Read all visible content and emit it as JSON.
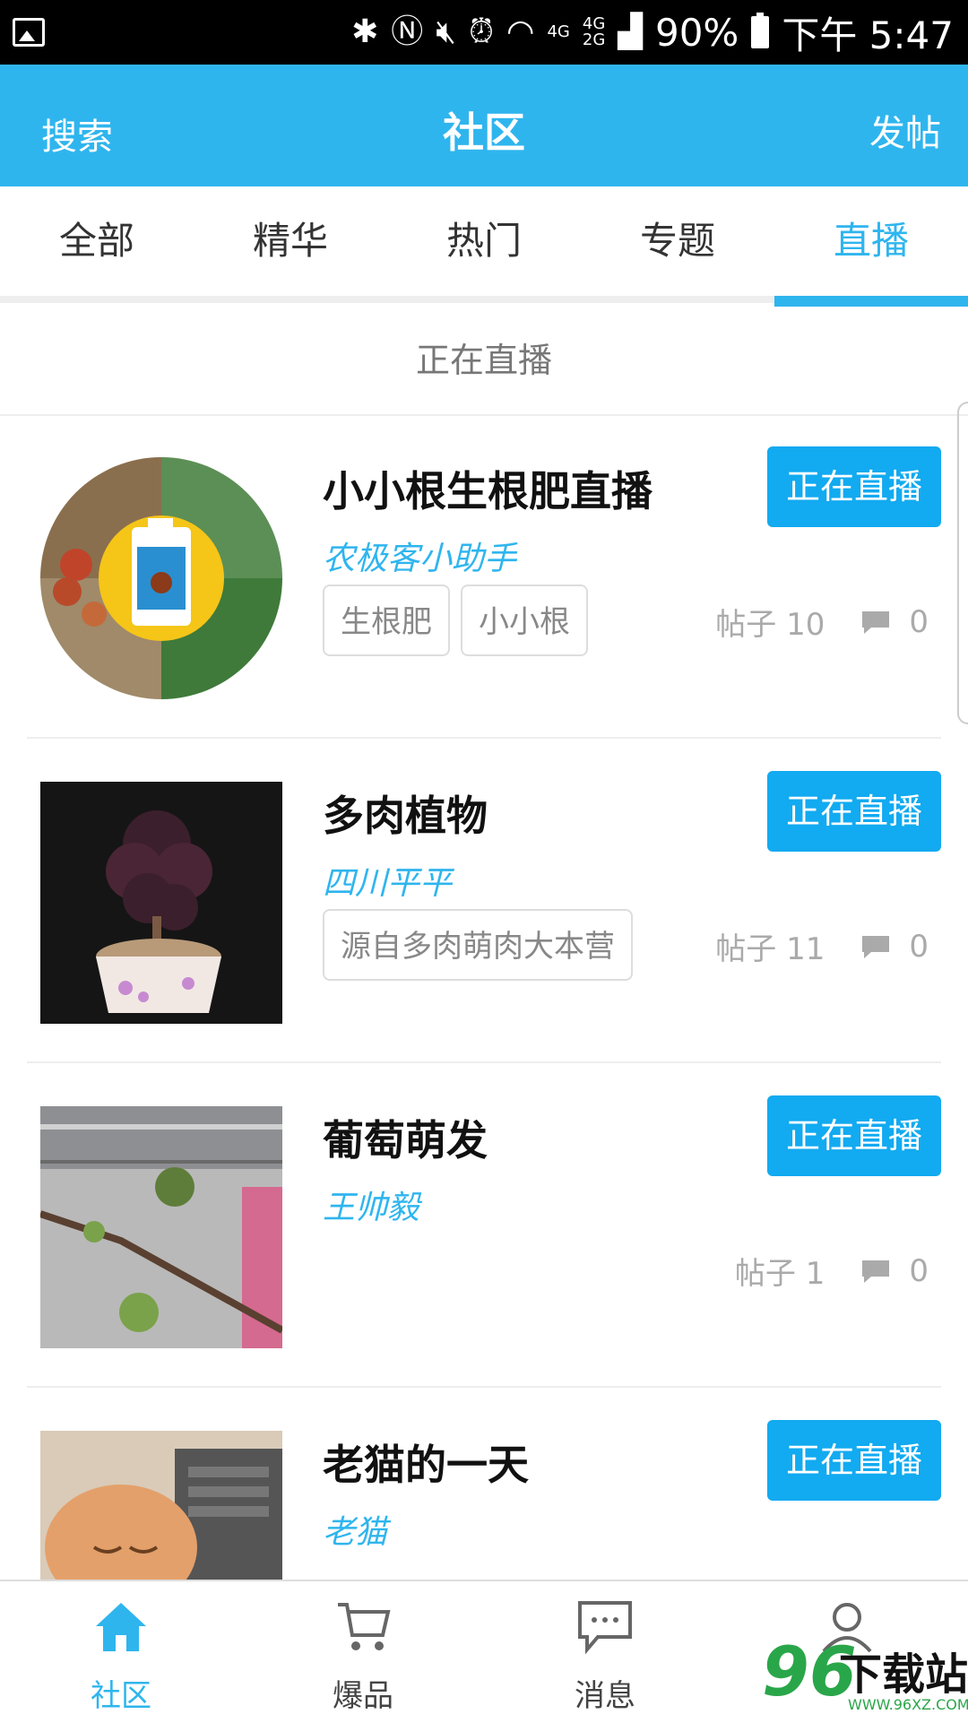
{
  "status_bar": {
    "time": "下午 5:47",
    "battery": "90%",
    "net_top": "4G",
    "net_bottom": "2G",
    "net_left": "4G"
  },
  "header": {
    "search": "搜索",
    "title": "社区",
    "post": "发帖"
  },
  "tabs": [
    {
      "label": "全部",
      "active": false
    },
    {
      "label": "精华",
      "active": false
    },
    {
      "label": "热门",
      "active": false
    },
    {
      "label": "专题",
      "active": false
    },
    {
      "label": "直播",
      "active": true
    }
  ],
  "section_title": "正在直播",
  "items": [
    {
      "title": "小小根生根肥直播",
      "author": "农极客小助手",
      "button": "正在直播",
      "tags": [
        "生根肥",
        "小小根"
      ],
      "posts": "帖子 10",
      "comments": "0"
    },
    {
      "title": "多肉植物",
      "author": "四川平平",
      "button": "正在直播",
      "tags": [
        "源自多肉萌肉大本营"
      ],
      "posts": "帖子 11",
      "comments": "0"
    },
    {
      "title": "葡萄萌发",
      "author": "王帅毅",
      "button": "正在直播",
      "tags": [],
      "posts": "帖子 1",
      "comments": "0"
    },
    {
      "title": "老猫的一天",
      "author": "老猫",
      "button": "正在直播",
      "tags": [],
      "posts": "",
      "comments": ""
    }
  ],
  "bottom_nav": [
    {
      "label": "社区",
      "icon": "home-icon",
      "active": true
    },
    {
      "label": "爆品",
      "icon": "cart-icon",
      "active": false
    },
    {
      "label": "消息",
      "icon": "message-icon",
      "active": false
    },
    {
      "label": "",
      "icon": "user-icon",
      "active": false
    }
  ],
  "watermark": {
    "num": "96",
    "text": "下载站",
    "url": "WWW.96XZ.COM"
  },
  "colors": {
    "accent": "#2fb5ee",
    "button": "#12aaf0"
  }
}
